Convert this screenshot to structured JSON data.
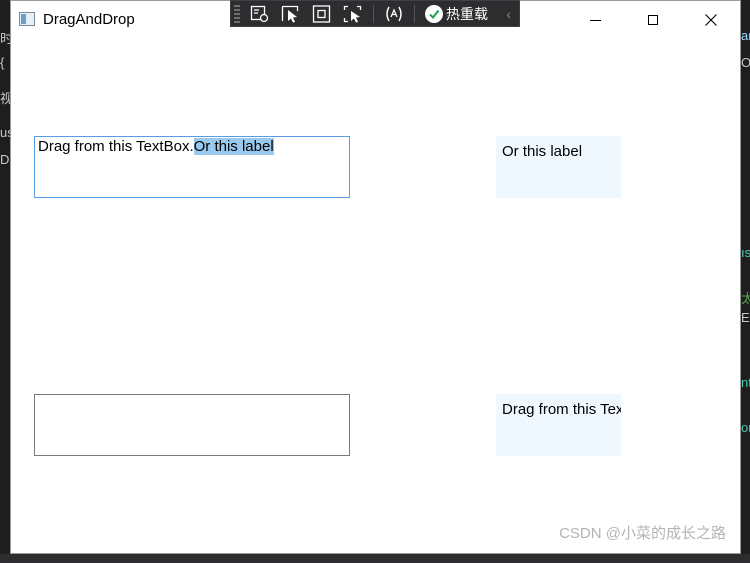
{
  "window": {
    "title": "DragAndDrop",
    "controls": {
      "minimize": "minimize",
      "maximize": "maximize",
      "close": "close"
    }
  },
  "devtools": {
    "hot_reload_label": "热重载"
  },
  "content": {
    "textbox1": {
      "plain_text": "Drag from this TextBox.",
      "selected_text": "Or this label"
    },
    "textbox2": {
      "value": ""
    },
    "label1": {
      "text": "Or this label"
    },
    "label2": {
      "text": "Drag from this TextBox."
    }
  },
  "watermark": "CSDN @小菜的成长之路",
  "background_fragments": [
    "时",
    "{",
    "视",
    "us",
    "D",
    "m",
    "ar",
    "Or",
    "ıs",
    "太",
    "E",
    "nt",
    "or"
  ],
  "colors": {
    "selection": "#99c9ef",
    "label_bg": "#f0f8ff",
    "focus_border": "#569de5",
    "devbar_bg": "#2d2d30"
  }
}
